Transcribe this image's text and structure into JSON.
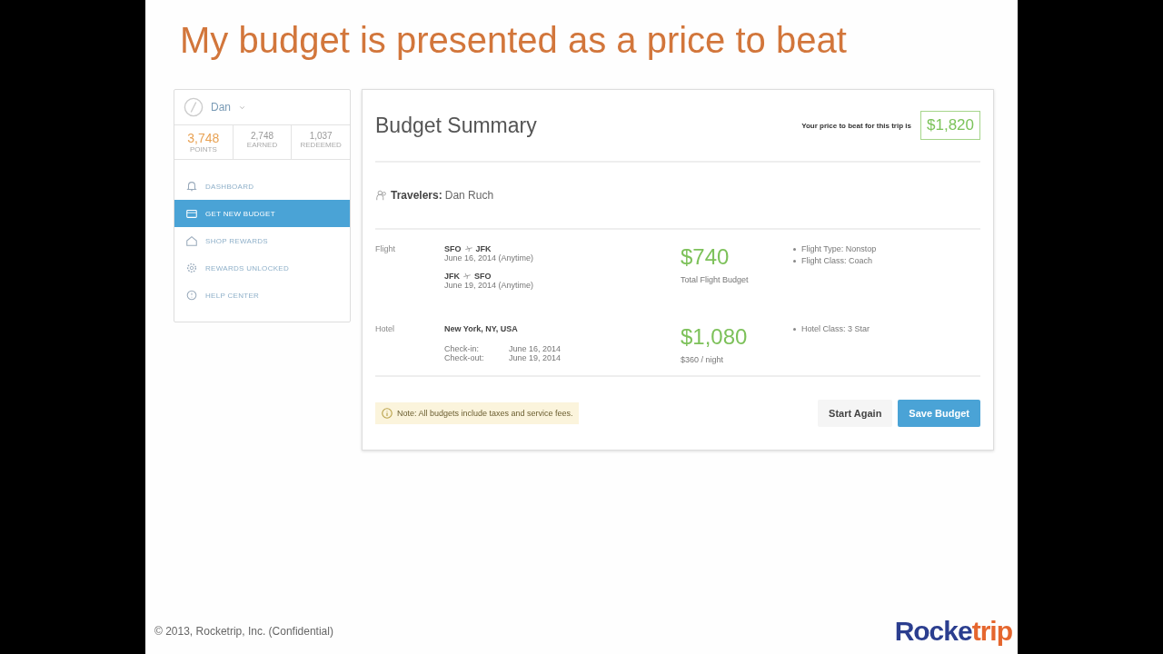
{
  "slide": {
    "title": "My budget is presented as a price to beat",
    "footer": "© 2013, Rocketrip, Inc. (Confidential)",
    "logo": [
      {
        "text": "Rocke",
        "color": "#2b3e8f"
      },
      {
        "text": "trip",
        "color": "#e5662e"
      }
    ]
  },
  "sidebar": {
    "user": "Dan",
    "stats": [
      {
        "value": "3,748",
        "label": "POINTS",
        "highlight": true
      },
      {
        "value": "2,748",
        "label": "EARNED",
        "highlight": false
      },
      {
        "value": "1,037",
        "label": "REDEEMED",
        "highlight": false
      }
    ],
    "items": [
      {
        "label": "DASHBOARD",
        "kind": "bell",
        "selected": false
      },
      {
        "label": "GET NEW BUDGET",
        "kind": "card",
        "selected": true
      },
      {
        "label": "SHOP REWARDS",
        "kind": "house",
        "selected": false
      },
      {
        "label": "REWARDS UNLOCKED",
        "kind": "gear",
        "selected": false
      },
      {
        "label": "HELP CENTER",
        "kind": "help",
        "selected": false
      }
    ]
  },
  "summary": {
    "title": "Budget Summary",
    "price_label": "Your price to beat for this trip is",
    "price": "$1,820",
    "travelers_label": "Travelers:",
    "travelers": "Dan Ruch",
    "sections": [
      {
        "label": "Flight",
        "kind": "flight",
        "legs": [
          {
            "from": "SFO",
            "to": "JFK",
            "date": "June 16, 2014 (Anytime)"
          },
          {
            "from": "JFK",
            "to": "SFO",
            "date": "June 19, 2014 (Anytime)"
          }
        ],
        "amount": "$740",
        "amount_note": "Total Flight Budget",
        "details": [
          "Flight Type: Nonstop",
          "Flight Class: Coach"
        ]
      },
      {
        "label": "Hotel",
        "kind": "hotel",
        "place": "New York, NY, USA",
        "rows": [
          {
            "key": "Check-in:",
            "value": "June 16, 2014"
          },
          {
            "key": "Check-out:",
            "value": "June 19, 2014"
          }
        ],
        "amount": "$1,080",
        "amount_note": "$360 / night",
        "details": [
          "Hotel Class: 3 Star"
        ]
      }
    ],
    "note": "Note: All budgets include taxes and service fees.",
    "buttons": [
      {
        "label": "Start Again",
        "kind": "secondary"
      },
      {
        "label": "Save Budget",
        "kind": "primary"
      }
    ]
  }
}
